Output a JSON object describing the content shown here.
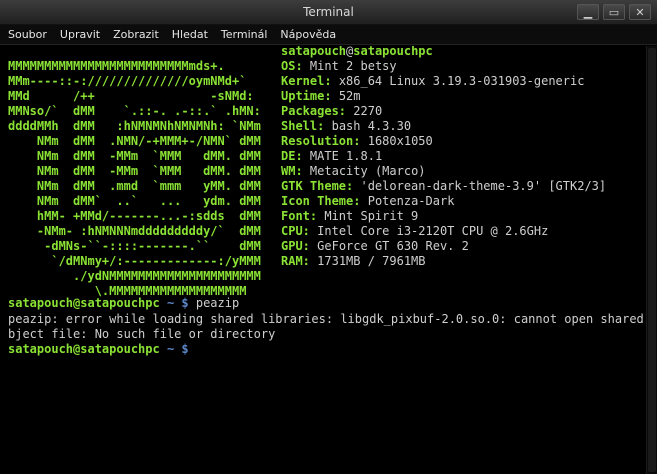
{
  "window": {
    "title": "Terminal",
    "controls": [
      "▁",
      "▭",
      "✕"
    ]
  },
  "menu": [
    "Soubor",
    "Upravit",
    "Zobrazit",
    "Hledat",
    "Terminál",
    "Nápověda"
  ],
  "info_header": {
    "user": "satapouch",
    "at": "@",
    "host": "satapouchpc"
  },
  "ascii_art": [
    "MMMMMMMMMMMMMMMMMMMMMMMMMmds+.",
    "MMm----::-://////////////oymNMd+`",
    "MMd      /++                -sNMd:",
    "MMNso/`  dMM    `.::-. .-::.` .hMN:",
    "ddddMMh  dMM   :hNMNMNhNMNMNh: `NMm",
    "    NMm  dMM  .NMN/-+MMM+-/NMN` dMM",
    "    NMm  dMM  -MMm  `MMM   dMM. dMM",
    "    NMm  dMM  -MMm  `MMM   dMM. dMM",
    "    NMm  dMM  .mmd  `mmm   yMM. dMM",
    "    NMm  dMM`  ..`   ...   ydm. dMM",
    "    hMM- +MMd/-------...-:sdds  dMM",
    "    -NMm- :hNMNNNmdddddddddy/`  dMM",
    "     -dMNs-``-::::-------.``    dMM",
    "      `/dMNmy+/:-------------:/yMMM",
    "         ./ydNMMMMMMMMMMMMMMMMMMMMM",
    "            \\.MMMMMMMMMMMMMMMMMMM"
  ],
  "info": [
    {
      "label": "OS:",
      "value": "Mint 2 betsy"
    },
    {
      "label": "Kernel:",
      "value": "x86_64 Linux 3.19.3-031903-generic"
    },
    {
      "label": "Uptime:",
      "value": "52m"
    },
    {
      "label": "Packages:",
      "value": "2270"
    },
    {
      "label": "Shell:",
      "value": "bash 4.3.30"
    },
    {
      "label": "Resolution:",
      "value": "1680x1050"
    },
    {
      "label": "DE:",
      "value": "MATE 1.8.1"
    },
    {
      "label": "WM:",
      "value": "Metacity (Marco)"
    },
    {
      "label": "GTK Theme:",
      "value": "'delorean-dark-theme-3.9' [GTK2/3]"
    },
    {
      "label": "Icon Theme:",
      "value": "Potenza-Dark"
    },
    {
      "label": "Font:",
      "value": "Mint Spirit 9"
    },
    {
      "label": "CPU:",
      "value": "Intel Core i3-2120T CPU @ 2.6GHz"
    },
    {
      "label": "GPU:",
      "value": "GeForce GT 630 Rev. 2"
    },
    {
      "label": "RAM:",
      "value": "1731MB / 7961MB"
    }
  ],
  "prompt": {
    "user_host": "satapouch@satapouchpc",
    "path_symbol": " ~ $"
  },
  "commands": [
    {
      "command": " peazip"
    }
  ],
  "output": [
    "peazip: error while loading shared libraries: libgdk_pixbuf-2.0.so.0: cannot open shared o",
    "bject file: No such file or directory"
  ],
  "second_prompt_command": ""
}
